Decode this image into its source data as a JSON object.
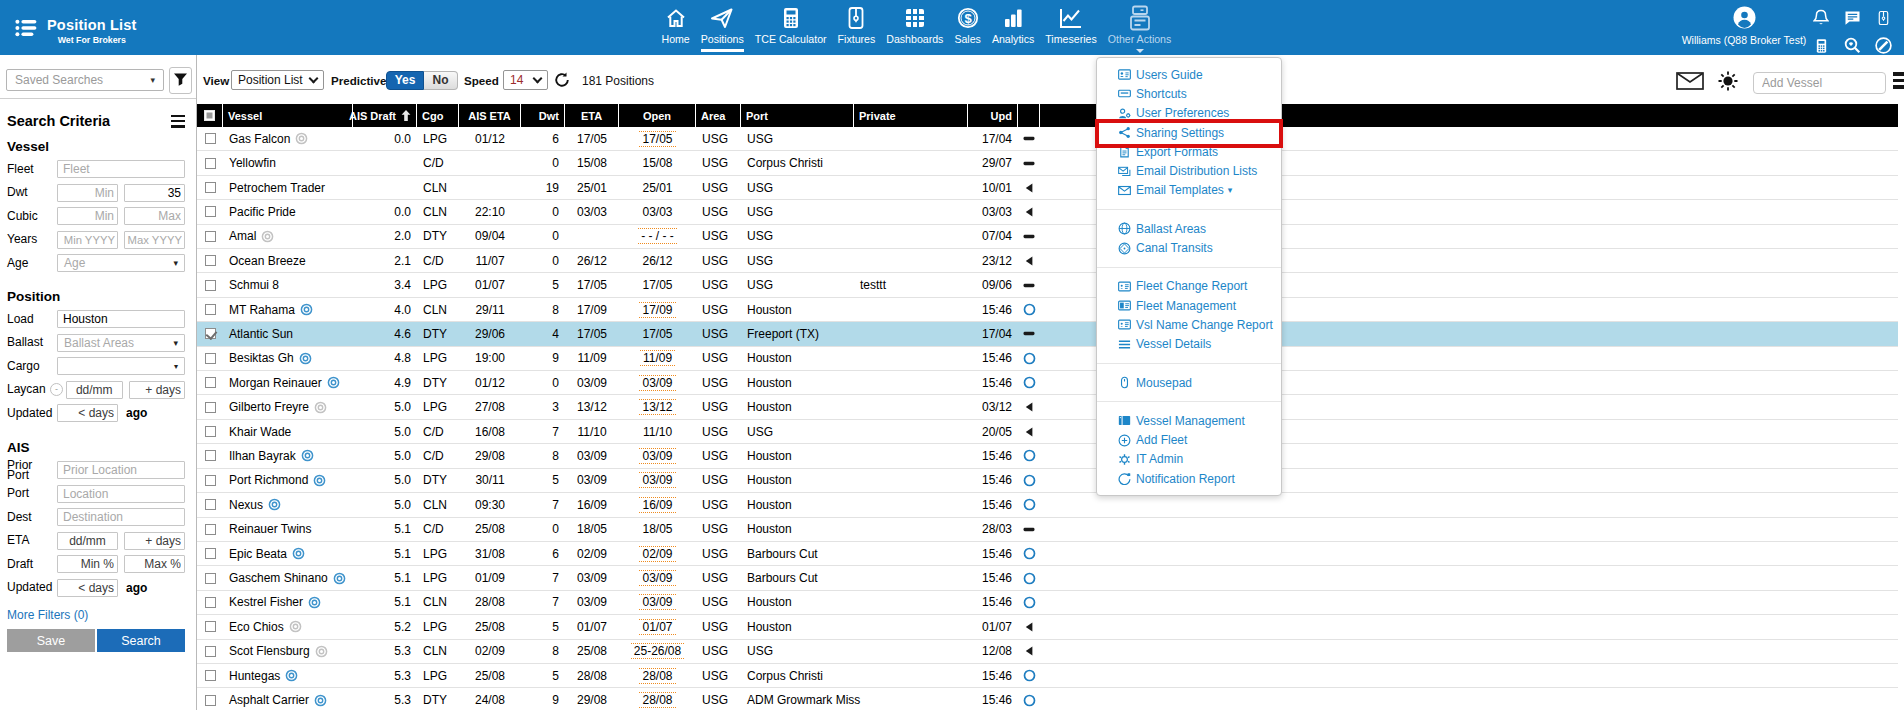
{
  "app": {
    "title": "Position List",
    "subtitle": "Wet For Brokers"
  },
  "topbar": {
    "nav": [
      {
        "label": "Home",
        "icon": "home"
      },
      {
        "label": "Positions",
        "icon": "send",
        "active": true
      },
      {
        "label": "TCE Calculator",
        "icon": "calculator"
      },
      {
        "label": "Fixtures",
        "icon": "zip"
      },
      {
        "label": "Dashboards",
        "icon": "grid"
      },
      {
        "label": "Sales",
        "icon": "dollar"
      },
      {
        "label": "Analytics",
        "icon": "barchart"
      },
      {
        "label": "Timeseries",
        "icon": "linechart"
      },
      {
        "label": "Other Actions",
        "icon": "stack",
        "dimmed": true,
        "open": true
      }
    ],
    "user": "Williams (Q88 Broker Test)",
    "quick_icons": [
      "bell",
      "chat",
      "zip",
      "calculator",
      "heartsearch",
      "editcircle"
    ]
  },
  "toolbar": {
    "saved_searches": "Saved Searches",
    "view_label": "View",
    "view_value": "Position List",
    "predictive_label": "Predictive",
    "yes": "Yes",
    "no": "No",
    "speed_label": "Speed",
    "speed_value": "14",
    "count": "181 Positions",
    "add_vessel": "Add Vessel"
  },
  "sidebar": {
    "title": "Search Criteria",
    "vessel": {
      "title": "Vessel",
      "fleet_label": "Fleet",
      "fleet_placeholder": "Fleet",
      "dwt_label": "Dwt",
      "dwt_min_placeholder": "Min",
      "dwt_max_value": "35",
      "cubic_label": "Cubic",
      "cubic_min_placeholder": "Min",
      "cubic_max_placeholder": "Max",
      "years_label": "Years",
      "years_min_placeholder": "Min YYYY",
      "years_max_placeholder": "Max YYYY",
      "age_label": "Age",
      "age_placeholder": "Age"
    },
    "position": {
      "title": "Position",
      "load_label": "Load",
      "load_value": "Houston",
      "ballast_label": "Ballast",
      "ballast_placeholder": "Ballast Areas",
      "cargo_label": "Cargo",
      "laycan_label": "Laycan",
      "laycan_minus": "-",
      "laycan_date_placeholder": "dd/mm",
      "laycan_days_placeholder": "+ days",
      "updated_label": "Updated",
      "updated_placeholder": "< days",
      "updated_suffix": "ago"
    },
    "ais": {
      "title": "AIS",
      "prior_port_label": "Prior\nPort",
      "prior_port_placeholder": "Prior Location",
      "port_label": "Port",
      "port_placeholder": "Location",
      "dest_label": "Dest",
      "dest_placeholder": "Destination",
      "eta_label": "ETA",
      "eta_date_placeholder": "dd/mm",
      "eta_days_placeholder": "+ days",
      "draft_label": "Draft",
      "draft_min_placeholder": "Min %",
      "draft_max_placeholder": "Max %",
      "updated_label": "Updated",
      "updated_placeholder": "< days",
      "updated_suffix": "ago"
    },
    "more_filters": "More Filters (0)",
    "save_button": "Save",
    "search_button": "Search"
  },
  "table": {
    "columns": [
      {
        "key": "check",
        "label": "",
        "width": 26,
        "align": "center"
      },
      {
        "key": "vessel",
        "label": "Vessel",
        "width": 130,
        "align": "left"
      },
      {
        "key": "ais_draft",
        "label": "AIS Draft",
        "width": 64,
        "align": "right",
        "sorted": "asc"
      },
      {
        "key": "cgo",
        "label": "Cgo",
        "width": 42,
        "align": "left"
      },
      {
        "key": "ais_eta",
        "label": "AIS ETA",
        "width": 62,
        "align": "center"
      },
      {
        "key": "dwt",
        "label": "Dwt",
        "width": 44,
        "align": "right"
      },
      {
        "key": "eta",
        "label": "ETA",
        "width": 54,
        "align": "center"
      },
      {
        "key": "open",
        "label": "Open",
        "width": 77,
        "align": "center"
      },
      {
        "key": "area",
        "label": "Area",
        "width": 45,
        "align": "left"
      },
      {
        "key": "port",
        "label": "Port",
        "width": 113,
        "align": "left"
      },
      {
        "key": "private",
        "label": "Private",
        "width": 114,
        "align": "left"
      },
      {
        "key": "upd",
        "label": "Upd",
        "width": 50,
        "align": "right"
      },
      {
        "key": "status",
        "label": "",
        "width": 22,
        "align": "center"
      }
    ],
    "rows": [
      {
        "vessel": "Gas Falcon",
        "marker": "gray",
        "ais_draft": "0.0",
        "cgo": "LPG",
        "ais_eta": "01/12",
        "dwt": "6",
        "eta": "17/05",
        "open": "17/05",
        "open_dotted": true,
        "area": "USG",
        "port": "USG",
        "private": "",
        "upd": "17/04",
        "status": "dash"
      },
      {
        "vessel": "Yellowfin",
        "marker": "",
        "ais_draft": "",
        "cgo": "C/D",
        "ais_eta": "",
        "dwt": "0",
        "eta": "15/08",
        "open": "15/08",
        "open_dotted": false,
        "area": "USG",
        "port": "Corpus Christi",
        "private": "",
        "upd": "29/07",
        "status": "dash"
      },
      {
        "vessel": "Petrochem Trader",
        "marker": "",
        "ais_draft": "",
        "cgo": "CLN",
        "ais_eta": "",
        "dwt": "19",
        "eta": "25/01",
        "open": "25/01",
        "open_dotted": false,
        "area": "USG",
        "port": "USG",
        "private": "",
        "upd": "10/01",
        "status": "tri"
      },
      {
        "vessel": "Pacific Pride",
        "marker": "",
        "ais_draft": "0.0",
        "cgo": "CLN",
        "ais_eta": "22:10",
        "dwt": "0",
        "eta": "03/03",
        "open": "03/03",
        "open_dotted": false,
        "area": "USG",
        "port": "USG",
        "private": "",
        "upd": "03/03",
        "status": "tri"
      },
      {
        "vessel": "Amal",
        "marker": "gray",
        "ais_draft": "2.0",
        "cgo": "DTY",
        "ais_eta": "09/04",
        "dwt": "0",
        "eta": "",
        "open": "- - / - -",
        "open_dotted": true,
        "area": "USG",
        "port": "USG",
        "private": "",
        "upd": "07/04",
        "status": "dash"
      },
      {
        "vessel": "Ocean Breeze",
        "marker": "",
        "ais_draft": "2.1",
        "cgo": "C/D",
        "ais_eta": "11/07",
        "dwt": "0",
        "eta": "26/12",
        "open": "26/12",
        "open_dotted": false,
        "area": "USG",
        "port": "USG",
        "private": "",
        "upd": "23/12",
        "status": "tri"
      },
      {
        "vessel": "Schmui 8",
        "marker": "",
        "ais_draft": "3.4",
        "cgo": "LPG",
        "ais_eta": "01/07",
        "dwt": "5",
        "eta": "17/05",
        "open": "17/05",
        "open_dotted": false,
        "area": "USG",
        "port": "USG",
        "private": "testtt",
        "upd": "09/06",
        "status": "dash"
      },
      {
        "vessel": "MT Rahama",
        "marker": "blue",
        "ais_draft": "4.0",
        "cgo": "CLN",
        "ais_eta": "29/11",
        "dwt": "8",
        "eta": "17/09",
        "open": "17/09",
        "open_dotted": true,
        "area": "USG",
        "port": "Houston",
        "private": "",
        "upd": "15:46",
        "status": "circle"
      },
      {
        "vessel": "Atlantic Sun",
        "marker": "",
        "ais_draft": "4.6",
        "cgo": "DTY",
        "ais_eta": "29/06",
        "dwt": "4",
        "eta": "17/05",
        "open": "17/05",
        "open_dotted": false,
        "area": "USG",
        "port": "Freeport (TX)",
        "private": "",
        "upd": "17/04",
        "status": "dash",
        "selected": true,
        "checked": true
      },
      {
        "vessel": "Besiktas Gh",
        "marker": "blue",
        "ais_draft": "4.8",
        "cgo": "LPG",
        "ais_eta": "19:00",
        "dwt": "9",
        "eta": "11/09",
        "open": "11/09",
        "open_dotted": true,
        "area": "USG",
        "port": "Houston",
        "private": "",
        "upd": "15:46",
        "status": "circle"
      },
      {
        "vessel": "Morgan Reinauer",
        "marker": "blue",
        "ais_draft": "4.9",
        "cgo": "DTY",
        "ais_eta": "01/12",
        "dwt": "0",
        "eta": "03/09",
        "open": "03/09",
        "open_dotted": true,
        "area": "USG",
        "port": "Houston",
        "private": "",
        "upd": "15:46",
        "status": "circle"
      },
      {
        "vessel": "Gilberto Freyre",
        "marker": "gray",
        "ais_draft": "5.0",
        "cgo": "LPG",
        "ais_eta": "27/08",
        "dwt": "3",
        "eta": "13/12",
        "open": "13/12",
        "open_dotted": true,
        "area": "USG",
        "port": "Houston",
        "private": "",
        "upd": "03/12",
        "status": "tri"
      },
      {
        "vessel": "Khair Wade",
        "marker": "",
        "ais_draft": "5.0",
        "cgo": "C/D",
        "ais_eta": "16/08",
        "dwt": "7",
        "eta": "11/10",
        "open": "11/10",
        "open_dotted": false,
        "area": "USG",
        "port": "USG",
        "private": "",
        "upd": "20/05",
        "status": "tri"
      },
      {
        "vessel": "Ilhan Bayrak",
        "marker": "blue",
        "ais_draft": "5.0",
        "cgo": "C/D",
        "ais_eta": "29/08",
        "dwt": "8",
        "eta": "03/09",
        "open": "03/09",
        "open_dotted": true,
        "area": "USG",
        "port": "Houston",
        "private": "",
        "upd": "15:46",
        "status": "circle"
      },
      {
        "vessel": "Port Richmond",
        "marker": "blue",
        "ais_draft": "5.0",
        "cgo": "DTY",
        "ais_eta": "30/11",
        "dwt": "5",
        "eta": "03/09",
        "open": "03/09",
        "open_dotted": true,
        "area": "USG",
        "port": "Houston",
        "private": "",
        "upd": "15:46",
        "status": "circle"
      },
      {
        "vessel": "Nexus",
        "marker": "blue",
        "ais_draft": "5.0",
        "cgo": "CLN",
        "ais_eta": "09:30",
        "dwt": "7",
        "eta": "16/09",
        "open": "16/09",
        "open_dotted": true,
        "area": "USG",
        "port": "Houston",
        "private": "",
        "upd": "15:46",
        "status": "circle"
      },
      {
        "vessel": "Reinauer Twins",
        "marker": "",
        "ais_draft": "5.1",
        "cgo": "C/D",
        "ais_eta": "25/08",
        "dwt": "0",
        "eta": "18/05",
        "open": "18/05",
        "open_dotted": false,
        "area": "USG",
        "port": "Houston",
        "private": "",
        "upd": "28/03",
        "status": "dash"
      },
      {
        "vessel": "Epic Beata",
        "marker": "blue",
        "ais_draft": "5.1",
        "cgo": "LPG",
        "ais_eta": "31/08",
        "dwt": "6",
        "eta": "02/09",
        "open": "02/09",
        "open_dotted": true,
        "area": "USG",
        "port": "Barbours Cut",
        "private": "",
        "upd": "15:46",
        "status": "circle"
      },
      {
        "vessel": "Gaschem Shinano",
        "marker": "blue",
        "ais_draft": "5.1",
        "cgo": "LPG",
        "ais_eta": "01/09",
        "dwt": "7",
        "eta": "03/09",
        "open": "03/09",
        "open_dotted": true,
        "area": "USG",
        "port": "Barbours Cut",
        "private": "",
        "upd": "15:46",
        "status": "circle"
      },
      {
        "vessel": "Kestrel Fisher",
        "marker": "blue",
        "ais_draft": "5.1",
        "cgo": "CLN",
        "ais_eta": "28/08",
        "dwt": "7",
        "eta": "03/09",
        "open": "03/09",
        "open_dotted": true,
        "area": "USG",
        "port": "Houston",
        "private": "",
        "upd": "15:46",
        "status": "circle"
      },
      {
        "vessel": "Eco Chios",
        "marker": "gray",
        "ais_draft": "5.2",
        "cgo": "LPG",
        "ais_eta": "25/08",
        "dwt": "5",
        "eta": "01/07",
        "open": "01/07",
        "open_dotted": true,
        "area": "USG",
        "port": "Houston",
        "private": "",
        "upd": "01/07",
        "status": "tri"
      },
      {
        "vessel": "Scot Flensburg",
        "marker": "gray",
        "ais_draft": "5.3",
        "cgo": "CLN",
        "ais_eta": "02/09",
        "dwt": "8",
        "eta": "25/08",
        "open": "25-26/08",
        "open_dotted": true,
        "area": "USG",
        "port": "USG",
        "private": "",
        "upd": "12/08",
        "status": "tri"
      },
      {
        "vessel": "Huntegas",
        "marker": "blue",
        "ais_draft": "5.3",
        "cgo": "LPG",
        "ais_eta": "25/08",
        "dwt": "5",
        "eta": "28/08",
        "open": "28/08",
        "open_dotted": true,
        "area": "USG",
        "port": "Corpus Christi",
        "private": "",
        "upd": "15:46",
        "status": "circle"
      },
      {
        "vessel": "Asphalt Carrier",
        "marker": "blue",
        "ais_draft": "5.3",
        "cgo": "DTY",
        "ais_eta": "24/08",
        "dwt": "9",
        "eta": "29/08",
        "open": "28/08",
        "open_dotted": true,
        "area": "USG",
        "port": "ADM Growmark Miss",
        "private": "",
        "upd": "15:46",
        "status": "circle"
      }
    ]
  },
  "menu": {
    "highlighted": "Sharing Settings",
    "groups": [
      [
        {
          "label": "Users Guide",
          "icon": "usersguide"
        },
        {
          "label": "Shortcuts",
          "icon": "shortcuts"
        },
        {
          "label": "User Preferences",
          "icon": "userprefs"
        },
        {
          "label": "Sharing Settings",
          "icon": "share"
        },
        {
          "label": "Export Formats",
          "icon": "exportfmt"
        },
        {
          "label": "Email Distribution Lists",
          "icon": "emaildist"
        },
        {
          "label": "Email Templates",
          "icon": "emailtpl",
          "caret": true
        }
      ],
      [
        {
          "label": "Ballast Areas",
          "icon": "globe"
        },
        {
          "label": "Canal Transits",
          "icon": "canal"
        }
      ],
      [
        {
          "label": "Fleet Change Report",
          "icon": "cardlist"
        },
        {
          "label": "Fleet Management",
          "icon": "cardfill"
        },
        {
          "label": "Vsl Name Change Report",
          "icon": "cardlist"
        },
        {
          "label": "Vessel Details",
          "icon": "hlines"
        }
      ],
      [
        {
          "label": "Mousepad",
          "icon": "mouse"
        }
      ],
      [
        {
          "label": "Vessel Management",
          "icon": "windowpane"
        },
        {
          "label": "Add Fleet",
          "icon": "pluscircle"
        },
        {
          "label": "IT Admin",
          "icon": "gear"
        },
        {
          "label": "Notification Report",
          "icon": "notifreport"
        }
      ]
    ]
  },
  "colors": {
    "topbar_blue": "#1478be",
    "menu_link_blue": "#1d86c8",
    "selected_row": "#b2dae9",
    "open_dotted_orange": "#ef8b1f",
    "annotation_red": "#d90e0e",
    "toggle_yes_blue": "#1565b0",
    "search_button_blue": "#1c6cb8",
    "save_button_gray": "#9e9e9e",
    "speed_value_red": "#9c2b2b"
  }
}
